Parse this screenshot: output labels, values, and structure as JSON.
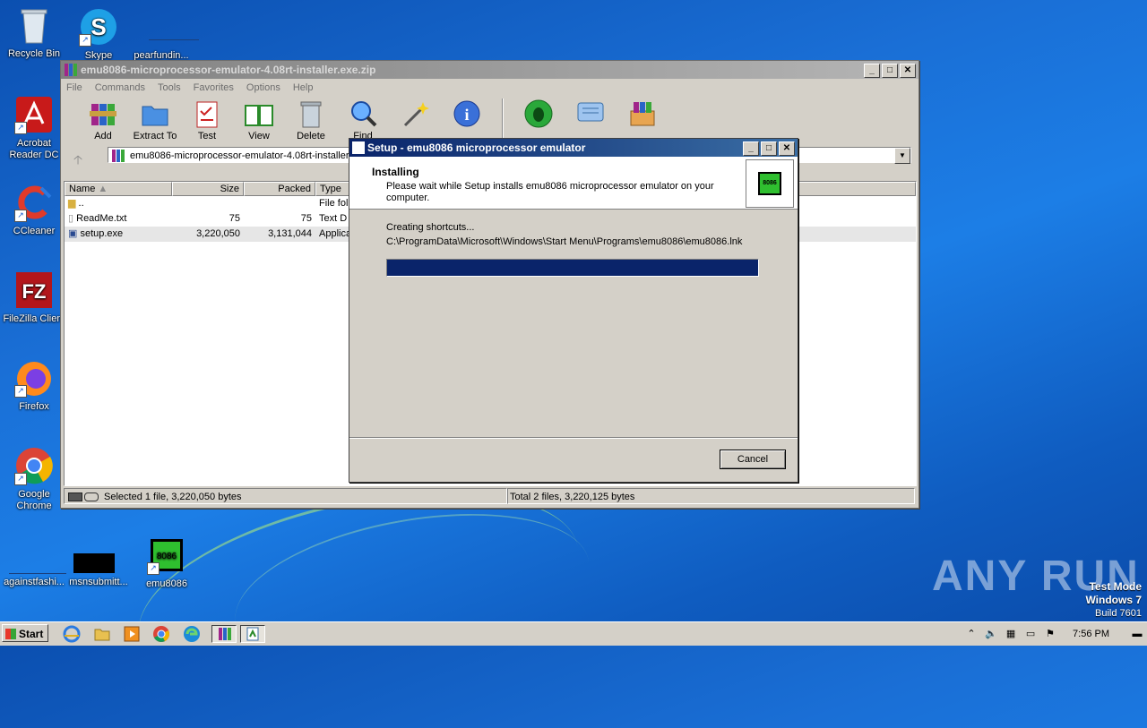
{
  "desktop": {
    "icons": [
      {
        "label": "Recycle Bin"
      },
      {
        "label": "Skype"
      },
      {
        "label": "pearfundin..."
      },
      {
        "label": "Acrobat Reader DC"
      },
      {
        "label": "CCleaner"
      },
      {
        "label": "FileZilla Client"
      },
      {
        "label": "Firefox"
      },
      {
        "label": "Google Chrome"
      },
      {
        "label": "againstfashi..."
      },
      {
        "label": "msnsubmitt..."
      },
      {
        "label": "emu8086"
      }
    ],
    "watermark": "ANY RUN",
    "test_mode": {
      "line1": "Test Mode",
      "line2": "Windows 7",
      "line3": "Build 7601"
    }
  },
  "winrar": {
    "title": "emu8086-microprocessor-emulator-4.08rt-installer.exe.zip",
    "menu": [
      "File",
      "Commands",
      "Tools",
      "Favorites",
      "Options",
      "Help"
    ],
    "toolbar": [
      "Add",
      "Extract To",
      "Test",
      "View",
      "Delete",
      "Find"
    ],
    "address": "emu8086-microprocessor-emulator-4.08rt-installer",
    "columns": [
      "Name",
      "Size",
      "Packed",
      "Type"
    ],
    "rows": [
      {
        "name": "..",
        "size": "",
        "packed": "",
        "type": "File fol"
      },
      {
        "name": "ReadMe.txt",
        "size": "75",
        "packed": "75",
        "type": "Text D"
      },
      {
        "name": "setup.exe",
        "size": "3,220,050",
        "packed": "3,131,044",
        "type": "Applica"
      }
    ],
    "status_left": "Selected 1 file, 3,220,050 bytes",
    "status_right": "Total 2 files, 3,220,125 bytes"
  },
  "setup": {
    "title": "Setup - emu8086 microprocessor emulator",
    "heading": "Installing",
    "subheading": "Please wait while Setup installs emu8086 microprocessor emulator on your computer.",
    "logo_text": "8086",
    "status": "Creating shortcuts...",
    "path": "C:\\ProgramData\\Microsoft\\Windows\\Start Menu\\Programs\\emu8086\\emu8086.lnk",
    "progress": 1.0,
    "cancel_label": "Cancel"
  },
  "taskbar": {
    "start_label": "Start",
    "clock": "7:56 PM"
  },
  "colors": {
    "desktop": "#1a6fd6",
    "title_active": "#0a246a",
    "title_inactive": "#808080",
    "progress": "#0a246a"
  }
}
